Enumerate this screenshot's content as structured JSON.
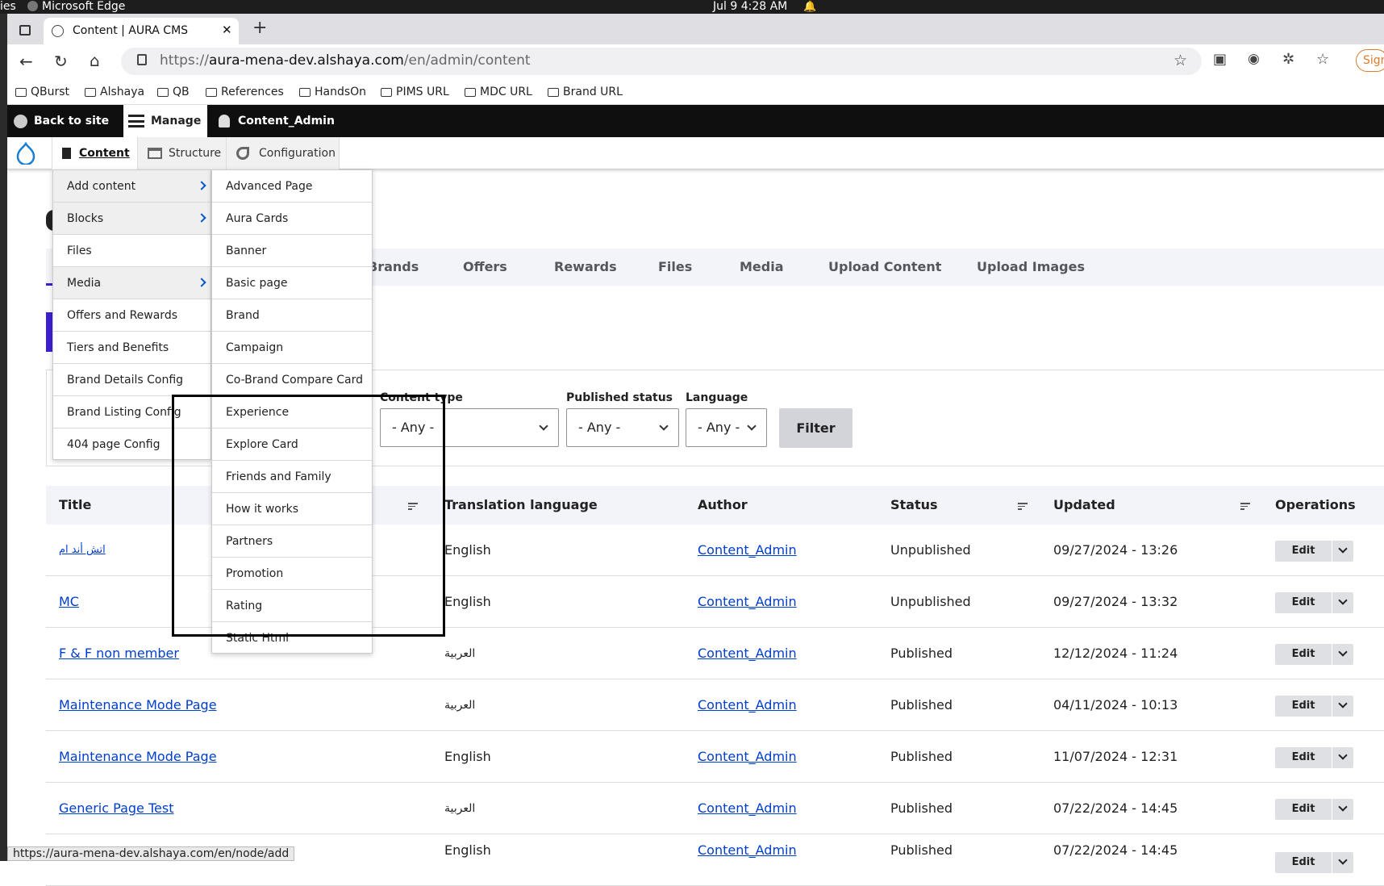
{
  "os": {
    "activities": "ies",
    "app": "Microsoft Edge",
    "clock": "Jul 9   4:28 AM"
  },
  "browser": {
    "tab_title": "Content | AURA CMS",
    "url_scheme": "https://",
    "url_host": "aura-mena-dev.alshaya.com",
    "url_path": "/en/admin/content",
    "profile_label": "Sign",
    "bookmarks": [
      "QBurst",
      "Alshaya",
      "QB",
      "References",
      "HandsOn",
      "PIMS URL",
      "MDC URL",
      "Brand URL"
    ]
  },
  "toolbar": {
    "back": "Back to site",
    "manage": "Manage",
    "user": "Content_Admin"
  },
  "tray": {
    "content": "Content",
    "structure": "Structure",
    "configuration": "Configuration"
  },
  "page_tabs": [
    "Brands",
    "Offers",
    "Rewards",
    "Files",
    "Media",
    "Upload Content",
    "Upload Images"
  ],
  "filters": {
    "content_type_label": "Content type",
    "content_type_value": "- Any -",
    "published_label": "Published status",
    "published_value": "- Any -",
    "language_label": "Language",
    "language_value": "- Any -",
    "filter_button": "Filter"
  },
  "table": {
    "headers": {
      "title": "Title",
      "translation": "Translation language",
      "author": "Author",
      "status": "Status",
      "updated": "Updated",
      "operations": "Operations"
    },
    "rows": [
      {
        "title": "اتش أند ام",
        "lang": "English",
        "author": "Content_Admin",
        "status": "Unpublished",
        "updated": "09/27/2024 - 13:26",
        "op": "Edit"
      },
      {
        "title": "MC",
        "lang": "English",
        "author": "Content_Admin",
        "status": "Unpublished",
        "updated": "09/27/2024 - 13:32",
        "op": "Edit"
      },
      {
        "title": "F & F non member",
        "lang": "العربية",
        "author": "Content_Admin",
        "status": "Published",
        "updated": "12/12/2024 - 11:24",
        "op": "Edit"
      },
      {
        "title": "Maintenance Mode Page",
        "lang": "العربية",
        "author": "Content_Admin",
        "status": "Published",
        "updated": "04/11/2024 - 10:13",
        "op": "Edit"
      },
      {
        "title": "Maintenance Mode Page",
        "lang": "English",
        "author": "Content_Admin",
        "status": "Published",
        "updated": "11/07/2024 - 12:31",
        "op": "Edit"
      },
      {
        "title": "Generic Page Test",
        "lang": "العربية",
        "author": "Content_Admin",
        "status": "Published",
        "updated": "07/22/2024 - 14:45",
        "op": "Edit"
      },
      {
        "title": "",
        "lang": "English",
        "author": "Content_Admin",
        "status": "Published",
        "updated": "07/22/2024 - 14:45",
        "op": "Edit"
      }
    ]
  },
  "menu_level1": [
    "Add content",
    "Blocks",
    "Files",
    "Media",
    "Offers and Rewards",
    "Tiers and Benefits",
    "Brand Details Config",
    "Brand Listing Config",
    "404 page Config"
  ],
  "menu_level2": [
    "Advanced Page",
    "Aura Cards",
    "Banner",
    "Basic page",
    "Brand",
    "Campaign",
    "Co-Brand Compare Card",
    "Experience",
    "Explore Card",
    "Friends and Family",
    "How it works",
    "Partners",
    "Promotion",
    "Rating",
    "Static Html"
  ],
  "status_url": "https://aura-mena-dev.alshaya.com/en/node/add"
}
